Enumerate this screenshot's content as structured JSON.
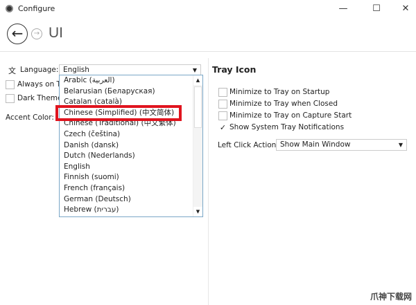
{
  "window": {
    "title": "Configure",
    "minimize": "—",
    "maximize": "☐",
    "close": "✕"
  },
  "header": {
    "back": "←",
    "forward": "→",
    "title": "UI"
  },
  "left": {
    "language_label": "Language:",
    "language_value": "English",
    "always_on_top": "Always on To",
    "dark_theme": "Dark Theme",
    "accent_color": "Accent Color:",
    "language_options": [
      "Arabic (العربية)",
      "Belarusian (Беларуская)",
      "Catalan (català)",
      "Chinese (Simplified) (中文简体)",
      "Chinese (Traditional) (中文繁体)",
      "Czech (čeština)",
      "Danish (dansk)",
      "Dutch (Nederlands)",
      "English",
      "Finnish (suomi)",
      "French (français)",
      "German (Deutsch)",
      "Hebrew (עברית)"
    ],
    "highlighted_option": "Chinese (Simplified) (中文简体)"
  },
  "right": {
    "heading": "Tray Icon",
    "options": [
      {
        "label": "Minimize to Tray on Startup",
        "checked": false
      },
      {
        "label": "Minimize to Tray when Closed",
        "checked": false
      },
      {
        "label": "Minimize to Tray on Capture Start",
        "checked": false
      },
      {
        "label": "Show System Tray Notifications",
        "checked": true
      }
    ],
    "left_click_label": "Left Click Action",
    "left_click_value": "Show Main Window",
    "check": "✓"
  },
  "watermark": "爪神下载网",
  "colors": {
    "highlight": "#e0141e",
    "list_border": "#7aa7c7"
  }
}
